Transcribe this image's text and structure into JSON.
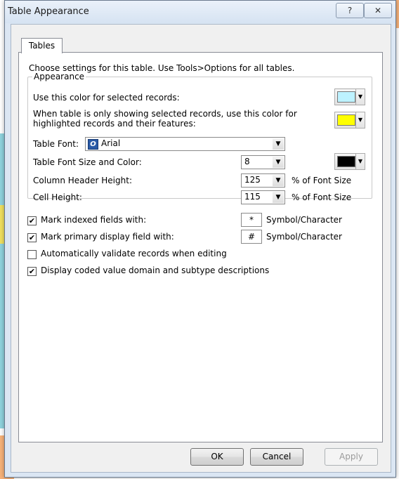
{
  "window": {
    "title": "Table Appearance",
    "help_btn": "?",
    "close_btn": "✕"
  },
  "tab": {
    "label": "Tables"
  },
  "intro_text": "Choose settings for this table. Use Tools>Options for all tables.",
  "appearance": {
    "legend": "Appearance",
    "selected_color_label": "Use this color for selected records:",
    "selected_color": "#bdf2ff",
    "highlight_label_1": "When table is only showing selected records, use this color for",
    "highlight_label_2": "highlighted records and their features:",
    "highlight_color": "#ffff00",
    "font_label": "Table Font:",
    "font_value": "Arial",
    "font_icon_glyph": "O",
    "font_size_label": "Table Font Size and Color:",
    "font_size_value": "8",
    "font_color": "#000000",
    "header_height_label": "Column Header Height:",
    "header_height_value": "125",
    "cell_height_label": "Cell Height:",
    "cell_height_value": "115",
    "pct_font_size": "% of Font Size"
  },
  "options": {
    "indexed_label": "Mark indexed fields with:",
    "indexed_checked": true,
    "indexed_symbol": "*",
    "primary_label": "Mark primary display field with:",
    "primary_checked": true,
    "primary_symbol": "#",
    "symbol_caption": "Symbol/Character",
    "validate_label": "Automatically validate records when editing",
    "validate_checked": false,
    "coded_label": "Display coded value domain and subtype descriptions",
    "coded_checked": true,
    "check_glyph": "✔"
  },
  "buttons": {
    "ok": "OK",
    "cancel": "Cancel",
    "apply": "Apply"
  },
  "icons": {
    "dropdown": "▼"
  }
}
